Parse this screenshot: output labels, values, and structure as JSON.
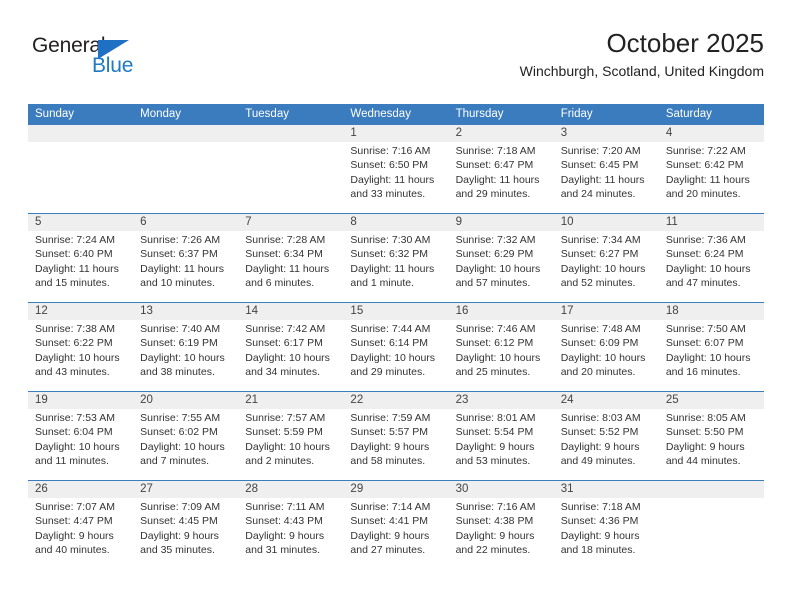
{
  "brand": {
    "name_part1": "General",
    "name_part2": "Blue",
    "triangle_color": "#1f6fc4",
    "blue_text_color": "#1f7ac4"
  },
  "header": {
    "title": "October 2025",
    "subtitle": "Winchburgh, Scotland, United Kingdom"
  },
  "theme": {
    "header_blue": "#3a7cbe",
    "daynum_band": "#efefef",
    "cell_background": "#ffffff"
  },
  "weekdays": [
    "Sunday",
    "Monday",
    "Tuesday",
    "Wednesday",
    "Thursday",
    "Friday",
    "Saturday"
  ],
  "weeks": [
    {
      "days": [
        {
          "num": "",
          "lines": [
            "",
            "",
            "",
            ""
          ]
        },
        {
          "num": "",
          "lines": [
            "",
            "",
            "",
            ""
          ]
        },
        {
          "num": "",
          "lines": [
            "",
            "",
            "",
            ""
          ]
        },
        {
          "num": "1",
          "lines": [
            "Sunrise: 7:16 AM",
            "Sunset: 6:50 PM",
            "Daylight: 11 hours",
            "and 33 minutes."
          ]
        },
        {
          "num": "2",
          "lines": [
            "Sunrise: 7:18 AM",
            "Sunset: 6:47 PM",
            "Daylight: 11 hours",
            "and 29 minutes."
          ]
        },
        {
          "num": "3",
          "lines": [
            "Sunrise: 7:20 AM",
            "Sunset: 6:45 PM",
            "Daylight: 11 hours",
            "and 24 minutes."
          ]
        },
        {
          "num": "4",
          "lines": [
            "Sunrise: 7:22 AM",
            "Sunset: 6:42 PM",
            "Daylight: 11 hours",
            "and 20 minutes."
          ]
        }
      ]
    },
    {
      "days": [
        {
          "num": "5",
          "lines": [
            "Sunrise: 7:24 AM",
            "Sunset: 6:40 PM",
            "Daylight: 11 hours",
            "and 15 minutes."
          ]
        },
        {
          "num": "6",
          "lines": [
            "Sunrise: 7:26 AM",
            "Sunset: 6:37 PM",
            "Daylight: 11 hours",
            "and 10 minutes."
          ]
        },
        {
          "num": "7",
          "lines": [
            "Sunrise: 7:28 AM",
            "Sunset: 6:34 PM",
            "Daylight: 11 hours",
            "and 6 minutes."
          ]
        },
        {
          "num": "8",
          "lines": [
            "Sunrise: 7:30 AM",
            "Sunset: 6:32 PM",
            "Daylight: 11 hours",
            "and 1 minute."
          ]
        },
        {
          "num": "9",
          "lines": [
            "Sunrise: 7:32 AM",
            "Sunset: 6:29 PM",
            "Daylight: 10 hours",
            "and 57 minutes."
          ]
        },
        {
          "num": "10",
          "lines": [
            "Sunrise: 7:34 AM",
            "Sunset: 6:27 PM",
            "Daylight: 10 hours",
            "and 52 minutes."
          ]
        },
        {
          "num": "11",
          "lines": [
            "Sunrise: 7:36 AM",
            "Sunset: 6:24 PM",
            "Daylight: 10 hours",
            "and 47 minutes."
          ]
        }
      ]
    },
    {
      "days": [
        {
          "num": "12",
          "lines": [
            "Sunrise: 7:38 AM",
            "Sunset: 6:22 PM",
            "Daylight: 10 hours",
            "and 43 minutes."
          ]
        },
        {
          "num": "13",
          "lines": [
            "Sunrise: 7:40 AM",
            "Sunset: 6:19 PM",
            "Daylight: 10 hours",
            "and 38 minutes."
          ]
        },
        {
          "num": "14",
          "lines": [
            "Sunrise: 7:42 AM",
            "Sunset: 6:17 PM",
            "Daylight: 10 hours",
            "and 34 minutes."
          ]
        },
        {
          "num": "15",
          "lines": [
            "Sunrise: 7:44 AM",
            "Sunset: 6:14 PM",
            "Daylight: 10 hours",
            "and 29 minutes."
          ]
        },
        {
          "num": "16",
          "lines": [
            "Sunrise: 7:46 AM",
            "Sunset: 6:12 PM",
            "Daylight: 10 hours",
            "and 25 minutes."
          ]
        },
        {
          "num": "17",
          "lines": [
            "Sunrise: 7:48 AM",
            "Sunset: 6:09 PM",
            "Daylight: 10 hours",
            "and 20 minutes."
          ]
        },
        {
          "num": "18",
          "lines": [
            "Sunrise: 7:50 AM",
            "Sunset: 6:07 PM",
            "Daylight: 10 hours",
            "and 16 minutes."
          ]
        }
      ]
    },
    {
      "days": [
        {
          "num": "19",
          "lines": [
            "Sunrise: 7:53 AM",
            "Sunset: 6:04 PM",
            "Daylight: 10 hours",
            "and 11 minutes."
          ]
        },
        {
          "num": "20",
          "lines": [
            "Sunrise: 7:55 AM",
            "Sunset: 6:02 PM",
            "Daylight: 10 hours",
            "and 7 minutes."
          ]
        },
        {
          "num": "21",
          "lines": [
            "Sunrise: 7:57 AM",
            "Sunset: 5:59 PM",
            "Daylight: 10 hours",
            "and 2 minutes."
          ]
        },
        {
          "num": "22",
          "lines": [
            "Sunrise: 7:59 AM",
            "Sunset: 5:57 PM",
            "Daylight: 9 hours",
            "and 58 minutes."
          ]
        },
        {
          "num": "23",
          "lines": [
            "Sunrise: 8:01 AM",
            "Sunset: 5:54 PM",
            "Daylight: 9 hours",
            "and 53 minutes."
          ]
        },
        {
          "num": "24",
          "lines": [
            "Sunrise: 8:03 AM",
            "Sunset: 5:52 PM",
            "Daylight: 9 hours",
            "and 49 minutes."
          ]
        },
        {
          "num": "25",
          "lines": [
            "Sunrise: 8:05 AM",
            "Sunset: 5:50 PM",
            "Daylight: 9 hours",
            "and 44 minutes."
          ]
        }
      ]
    },
    {
      "days": [
        {
          "num": "26",
          "lines": [
            "Sunrise: 7:07 AM",
            "Sunset: 4:47 PM",
            "Daylight: 9 hours",
            "and 40 minutes."
          ]
        },
        {
          "num": "27",
          "lines": [
            "Sunrise: 7:09 AM",
            "Sunset: 4:45 PM",
            "Daylight: 9 hours",
            "and 35 minutes."
          ]
        },
        {
          "num": "28",
          "lines": [
            "Sunrise: 7:11 AM",
            "Sunset: 4:43 PM",
            "Daylight: 9 hours",
            "and 31 minutes."
          ]
        },
        {
          "num": "29",
          "lines": [
            "Sunrise: 7:14 AM",
            "Sunset: 4:41 PM",
            "Daylight: 9 hours",
            "and 27 minutes."
          ]
        },
        {
          "num": "30",
          "lines": [
            "Sunrise: 7:16 AM",
            "Sunset: 4:38 PM",
            "Daylight: 9 hours",
            "and 22 minutes."
          ]
        },
        {
          "num": "31",
          "lines": [
            "Sunrise: 7:18 AM",
            "Sunset: 4:36 PM",
            "Daylight: 9 hours",
            "and 18 minutes."
          ]
        },
        {
          "num": "",
          "lines": [
            "",
            "",
            "",
            ""
          ]
        }
      ]
    }
  ]
}
